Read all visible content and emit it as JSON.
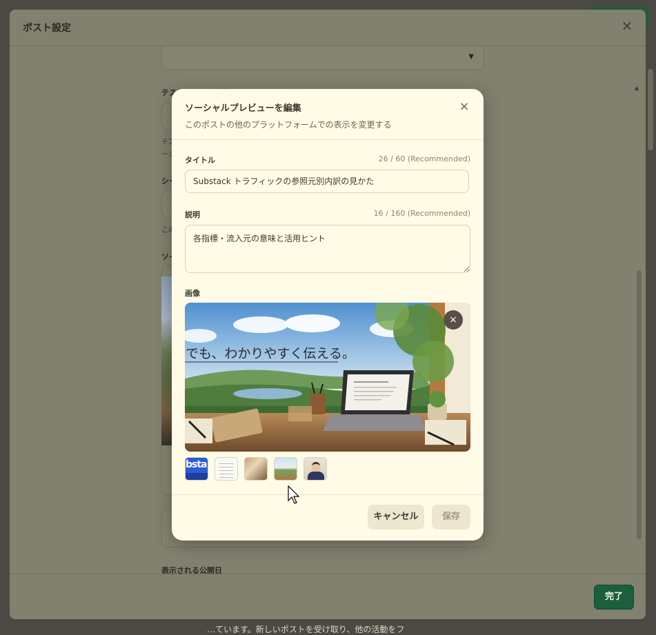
{
  "outer": {
    "title": "ポスト設定",
    "close_icon": "×",
    "done_label": "完了",
    "labels": {
      "test_send": "テストメールを送信",
      "test_desc_1": "テストメ",
      "test_desc_2": "ージ",
      "seo": "シー",
      "seo_desc": "この",
      "social": "ソー",
      "publish_date": "表示される公開日"
    },
    "background_footer_text": "…ています。新しいポストを受け取り、他の活動をフ"
  },
  "modal": {
    "title": "ソーシャルプレビューを編集",
    "subtitle": "このポストの他のプラットフォームでの表示を変更する",
    "title_field": {
      "label": "タイトル",
      "counter": "26 / 60 (Recommended)",
      "value": "Substack トラフィックの参照元別内訳の見かた"
    },
    "description_field": {
      "label": "説明",
      "counter": "16 / 160 (Recommended)",
      "value": "各指標・流入元の意味と活用ヒント"
    },
    "image": {
      "label": "画像",
      "caption": "でも、わかりやすく伝える。",
      "remove_icon": "×",
      "thumbnails": [
        {
          "name": "substack-title-thumb",
          "text": "bsta"
        },
        {
          "name": "table-doc-thumb"
        },
        {
          "name": "desk-photo-thumb"
        },
        {
          "name": "window-landscape-thumb",
          "selected": true
        },
        {
          "name": "portrait-illustration-thumb"
        }
      ]
    },
    "buttons": {
      "cancel": "キャンセル",
      "save": "保存"
    },
    "close_icon": "×"
  },
  "colors": {
    "modal_bg": "#fffbe6",
    "done_button": "#1b5f3d",
    "overlay": "#82816f"
  }
}
